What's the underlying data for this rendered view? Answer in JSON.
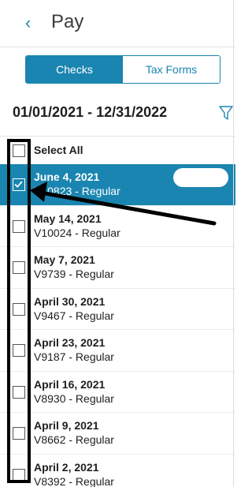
{
  "header": {
    "back_icon": "chevron-left-icon",
    "back_glyph": "‹",
    "title": "Pay"
  },
  "tabs": [
    {
      "label": "Checks",
      "active": true
    },
    {
      "label": "Tax Forms",
      "active": false
    }
  ],
  "date_range": "01/01/2021 - 12/31/2022",
  "filter_icon": "filter-icon",
  "select_all": {
    "label": "Select All",
    "checked": false
  },
  "checks": [
    {
      "date": "June 4, 2021",
      "detail": "V10823 - Regular",
      "checked": true,
      "selected": true
    },
    {
      "date": "May 14, 2021",
      "detail": "V10024 - Regular",
      "checked": false,
      "selected": false
    },
    {
      "date": "May 7, 2021",
      "detail": "V9739 - Regular",
      "checked": false,
      "selected": false
    },
    {
      "date": "April 30, 2021",
      "detail": "V9467 - Regular",
      "checked": false,
      "selected": false
    },
    {
      "date": "April 23, 2021",
      "detail": "V9187 - Regular",
      "checked": false,
      "selected": false
    },
    {
      "date": "April 16, 2021",
      "detail": "V8930 - Regular",
      "checked": false,
      "selected": false
    },
    {
      "date": "April 9, 2021",
      "detail": "V8662 - Regular",
      "checked": false,
      "selected": false
    },
    {
      "date": "April 2, 2021",
      "detail": "V8392 - Regular",
      "checked": false,
      "selected": false
    }
  ],
  "colors": {
    "accent": "#1a85b0",
    "annotation": "#000000"
  }
}
